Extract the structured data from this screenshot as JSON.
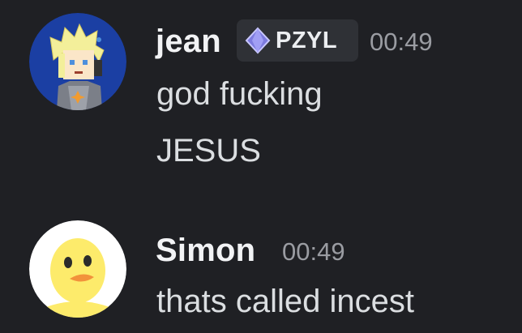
{
  "messages": [
    {
      "author": "jean",
      "tag": {
        "label": "PZYL",
        "icon": "gem-icon",
        "color": "#8e8cf0"
      },
      "timestamp": "00:49",
      "lines": [
        "god fucking",
        "JESUS"
      ]
    },
    {
      "author": "Simon",
      "timestamp": "00:49",
      "lines": [
        "thats called incest"
      ]
    }
  ],
  "colors": {
    "background": "#1f2024",
    "username": "#f2f3f5",
    "timestamp": "#9a9ca2",
    "message_text": "#dbdee1",
    "tag_background": "#2f3136"
  }
}
